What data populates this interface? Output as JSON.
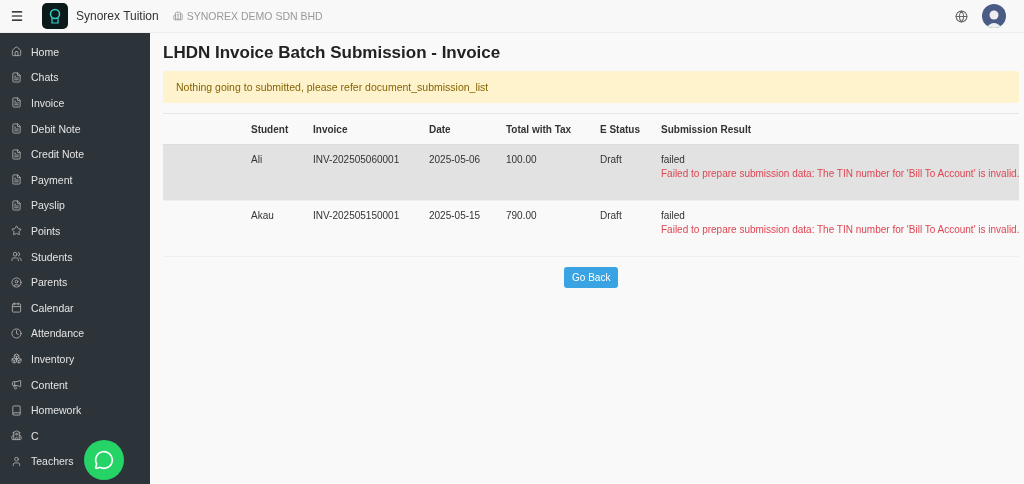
{
  "topbar": {
    "app_name": "Synorex Tuition",
    "company": "SYNOREX DEMO SDN BHD"
  },
  "sidebar": {
    "items": [
      {
        "label": "Home",
        "selected": false
      },
      {
        "label": "Chats",
        "selected": false
      },
      {
        "label": "Invoice",
        "selected": false
      },
      {
        "label": "Debit Note",
        "selected": false
      },
      {
        "label": "Credit Note",
        "selected": false
      },
      {
        "label": "Payment",
        "selected": false
      },
      {
        "label": "Payslip",
        "selected": false
      },
      {
        "label": "Points",
        "selected": false
      },
      {
        "label": "Students",
        "selected": false
      },
      {
        "label": "Parents",
        "selected": false
      },
      {
        "label": "Calendar",
        "selected": false
      },
      {
        "label": "Attendance",
        "selected": false
      },
      {
        "label": "Inventory",
        "selected": false
      },
      {
        "label": "Content",
        "selected": false
      },
      {
        "label": "Homework",
        "selected": false
      },
      {
        "label": "C",
        "selected": false
      },
      {
        "label": "Teachers",
        "selected": false
      }
    ]
  },
  "page": {
    "title": "LHDN Invoice Batch Submission - Invoice",
    "alert": "Nothing going to submitted, please refer document_submission_list",
    "table": {
      "columns": [
        "Student",
        "Invoice",
        "Date",
        "Total with Tax",
        "E Status",
        "Submission Result"
      ],
      "rows": [
        {
          "highlighted": true,
          "student": "Ali",
          "invoice": "INV-202505060001",
          "date": "2025-05-06",
          "total": "100.00",
          "e_status": "Draft",
          "result": "failed",
          "error": "Failed to prepare submission data: The TIN number for 'Bill To Account' is invalid."
        },
        {
          "highlighted": false,
          "student": "Akau",
          "invoice": "INV-202505150001",
          "date": "2025-05-15",
          "total": "790.00",
          "e_status": "Draft",
          "result": "failed",
          "error": "Failed to prepare submission data: The TIN number for 'Bill To Account' is invalid."
        }
      ]
    },
    "button": "Go Back"
  }
}
